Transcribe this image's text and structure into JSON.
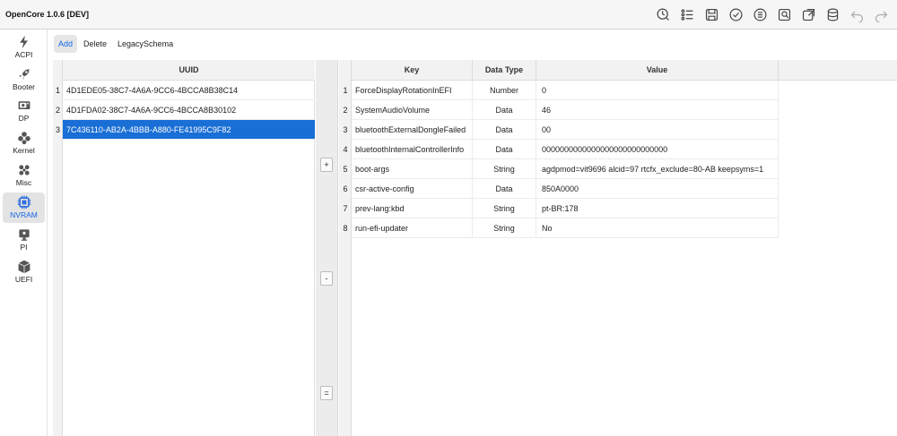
{
  "app": {
    "title": "OpenCore 1.0.6 [DEV]"
  },
  "toolbar": {
    "buttons": [
      "history-icon",
      "list-icon",
      "save-icon",
      "check-icon",
      "list-circle-icon",
      "image-search-icon",
      "export-icon",
      "database-icon",
      "undo-icon",
      "redo-icon"
    ]
  },
  "sidebar": {
    "items": [
      {
        "label": "ACPI",
        "icon": "lightning-icon"
      },
      {
        "label": "Booter",
        "icon": "rocket-icon"
      },
      {
        "label": "DP",
        "icon": "device-icon"
      },
      {
        "label": "Kernel",
        "icon": "kernel-icon"
      },
      {
        "label": "Misc",
        "icon": "misc-icon"
      },
      {
        "label": "NVRAM",
        "icon": "chip-icon",
        "active": true
      },
      {
        "label": "PI",
        "icon": "platform-icon"
      },
      {
        "label": "UEFI",
        "icon": "cube-icon"
      }
    ]
  },
  "subtabs": {
    "add": "Add",
    "delete": "Delete",
    "legacy": "LegacySchema"
  },
  "uuid_table": {
    "header": "UUID",
    "rows": [
      {
        "num": "1",
        "uuid": "4D1EDE05-38C7-4A6A-9CC6-4BCCA8B38C14"
      },
      {
        "num": "2",
        "uuid": "4D1FDA02-38C7-4A6A-9CC6-4BCCA8B30102"
      },
      {
        "num": "3",
        "uuid": "7C436110-AB2A-4BBB-A880-FE41995C9F82"
      }
    ]
  },
  "mid_buttons": {
    "add": "+",
    "remove": "-",
    "equal": "="
  },
  "kv_table": {
    "headers": {
      "key": "Key",
      "type": "Data Type",
      "value": "Value"
    },
    "rows": [
      {
        "num": "1",
        "key": "ForceDisplayRotationInEFI",
        "type": "Number",
        "value": "0"
      },
      {
        "num": "2",
        "key": "SystemAudioVolume",
        "type": "Data",
        "value": "46"
      },
      {
        "num": "3",
        "key": "bluetoothExternalDongleFailed",
        "type": "Data",
        "value": "00"
      },
      {
        "num": "4",
        "key": "bluetoothInternalControllerInfo",
        "type": "Data",
        "value": "0000000000000000000000000000"
      },
      {
        "num": "5",
        "key": "boot-args",
        "type": "String",
        "value": "agdpmod=vit9696 alcid=97 rtcfx_exclude=80-AB keepsyms=1"
      },
      {
        "num": "6",
        "key": "csr-active-config",
        "type": "Data",
        "value": "850A0000"
      },
      {
        "num": "7",
        "key": "prev-lang:kbd",
        "type": "String",
        "value": "pt-BR:178"
      },
      {
        "num": "8",
        "key": "run-efi-updater",
        "type": "String",
        "value": "No"
      }
    ]
  },
  "colors": {
    "accent": "#1565e6",
    "selection": "#1a6fd6",
    "chip": "#2f6fe0"
  }
}
